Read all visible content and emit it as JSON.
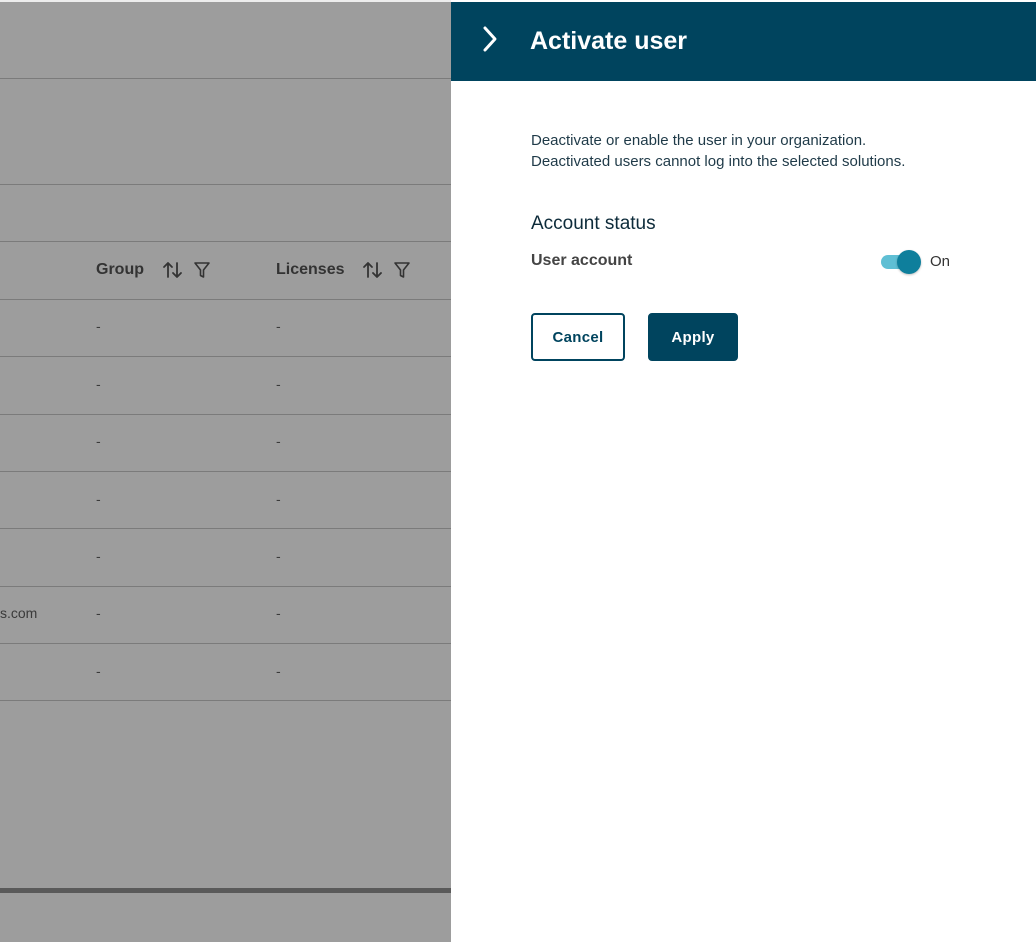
{
  "table": {
    "columns": [
      {
        "label": "Group"
      },
      {
        "label": "Licenses"
      }
    ],
    "rows": [
      {
        "partial_email": "",
        "group": "-",
        "licenses": "-"
      },
      {
        "partial_email": "",
        "group": "-",
        "licenses": "-"
      },
      {
        "partial_email": "",
        "group": "-",
        "licenses": "-"
      },
      {
        "partial_email": "",
        "group": "-",
        "licenses": "-"
      },
      {
        "partial_email": "",
        "group": "-",
        "licenses": "-"
      },
      {
        "partial_email": "s.com",
        "group": "-",
        "licenses": "-"
      },
      {
        "partial_email": "",
        "group": "-",
        "licenses": "-"
      }
    ]
  },
  "panel": {
    "title": "Activate user",
    "description_line1": "Deactivate or enable the user in your organization.",
    "description_line2": "Deactivated users cannot log into the selected solutions.",
    "section_title": "Account status",
    "field_label": "User account",
    "toggle_state": "On",
    "cancel_label": "Cancel",
    "apply_label": "Apply"
  },
  "colors": {
    "header_bg": "#00445e",
    "toggle_track": "#5fbfd4",
    "toggle_knob": "#0e7f9c",
    "overlay": "#9d9d9d"
  },
  "icons": {
    "sort": "sort-icon",
    "filter": "filter-icon",
    "collapse": "chevron-right-icon"
  }
}
